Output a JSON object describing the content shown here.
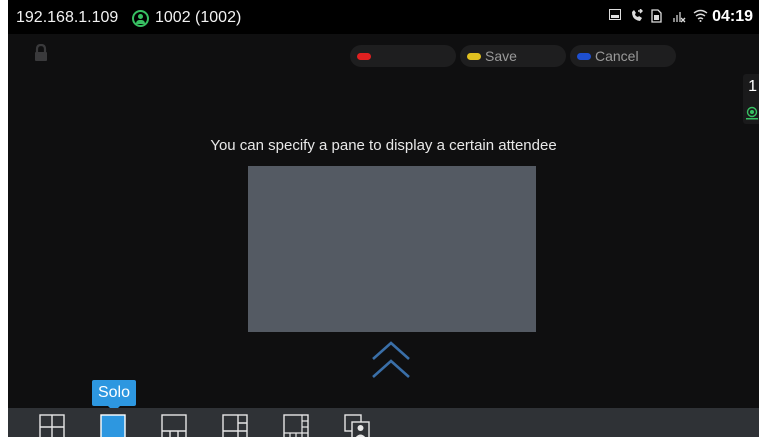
{
  "status_bar": {
    "ip": "192.168.1.109",
    "account": "1002 (1002)",
    "time": "04:19",
    "icons": [
      "image-icon",
      "call-forward-icon",
      "sim-icon",
      "no-signal-icon",
      "wifi-icon"
    ]
  },
  "toolbar": {
    "buttons": [
      {
        "color": "#e02020",
        "label": ""
      },
      {
        "color": "#e0c020",
        "label": "Save"
      },
      {
        "color": "#1e4fd0",
        "label": "Cancel"
      }
    ]
  },
  "side_panel": {
    "count": "1"
  },
  "main": {
    "hint": "You can specify a pane to display a certain attendee"
  },
  "layouts": {
    "tooltip": "Solo",
    "items": [
      "grid-layout-icon",
      "solo-layout-icon",
      "bottom-row-layout-icon",
      "right-grid-layout-icon",
      "side-column-layout-icon",
      "picture-in-picture-layout-icon"
    ],
    "selected": 1
  },
  "colors": {
    "accent": "#2d97e0",
    "preview": "#545a63",
    "chevron": "#3a6fa8"
  }
}
